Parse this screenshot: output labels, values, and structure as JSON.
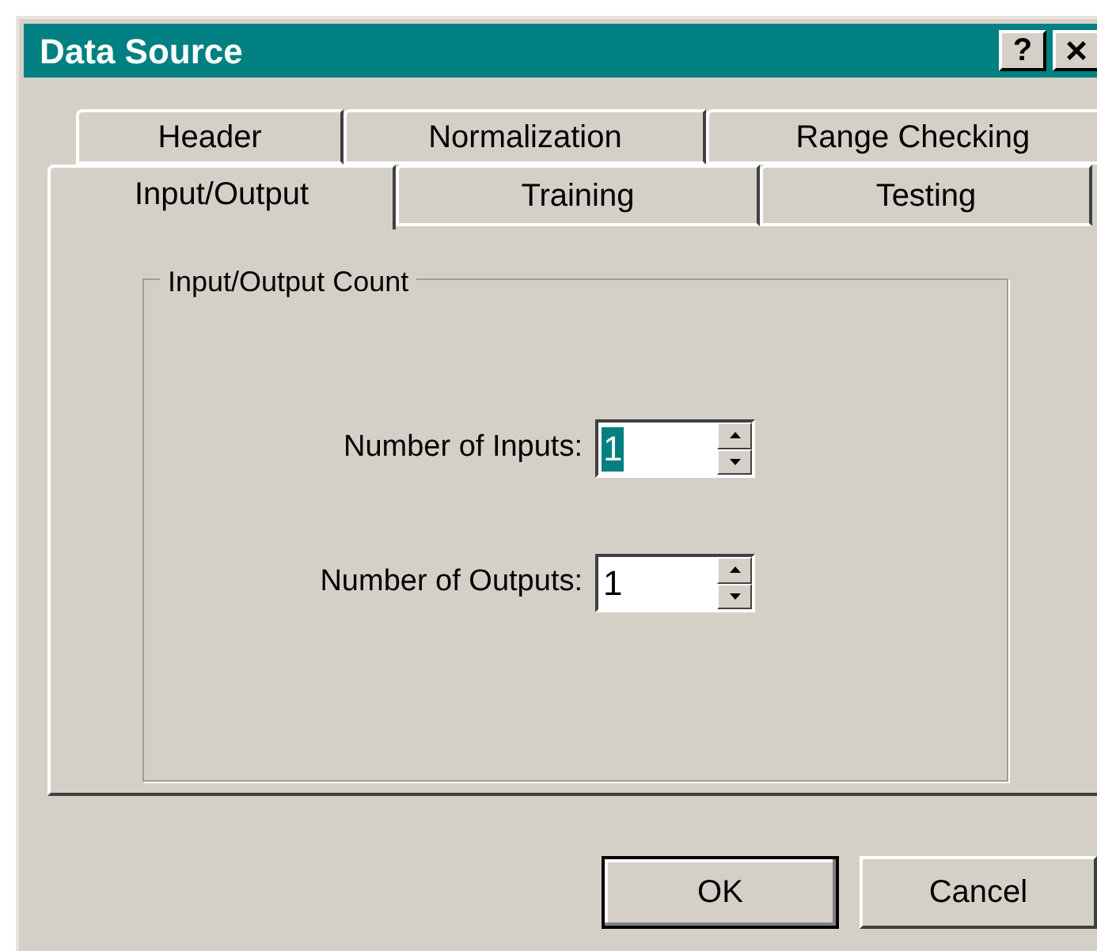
{
  "window": {
    "title": "Data Source",
    "help_button": "?",
    "close_button": "×"
  },
  "tab_rows": [
    [
      {
        "label": "Header",
        "selected": false
      },
      {
        "label": "Normalization",
        "selected": false
      },
      {
        "label": "Range Checking",
        "selected": false
      }
    ],
    [
      {
        "label": "Input/Output",
        "selected": true
      },
      {
        "label": "Training",
        "selected": false
      },
      {
        "label": "Testing",
        "selected": false
      }
    ]
  ],
  "group": {
    "title": "Input/Output Count",
    "fields": [
      {
        "label": "Number of Inputs:",
        "value": "1",
        "text_selected": true
      },
      {
        "label": "Number of Outputs:",
        "value": "1",
        "text_selected": false
      }
    ]
  },
  "buttons": [
    {
      "label": "OK",
      "default": true
    },
    {
      "label": "Cancel",
      "default": false
    }
  ]
}
